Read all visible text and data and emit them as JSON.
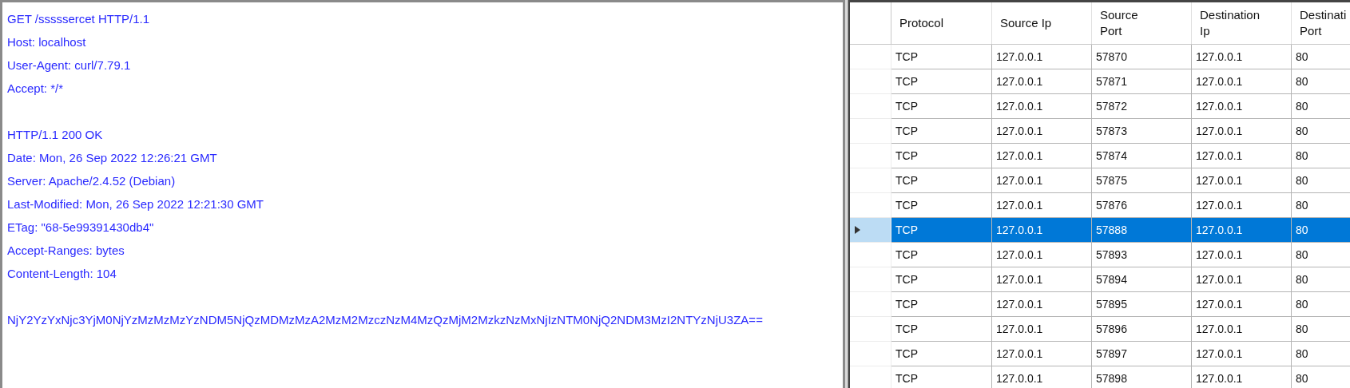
{
  "message_view": {
    "blocks": [
      {
        "lines": [
          "GET /sssssercet HTTP/1.1",
          "Host: localhost",
          "User-Agent: curl/7.79.1",
          "Accept: */*"
        ]
      },
      {
        "lines": [
          "HTTP/1.1 200 OK",
          "Date: Mon, 26 Sep 2022 12:26:21 GMT",
          "Server: Apache/2.4.52 (Debian)",
          "Last-Modified: Mon, 26 Sep 2022 12:21:30 GMT",
          "ETag: \"68-5e99391430db4\"",
          "Accept-Ranges: bytes",
          "Content-Length: 104"
        ]
      },
      {
        "lines": [
          "NjY2YzYxNjc3YjM0NjYzMzMzMzYzNDM5NjQzMDMzMzA2MzM2MzczNzM4MzQzMjM2MzkzNzMxNjIzNTM0NjQ2NDM3MzI2NTYzNjU3ZA=="
        ]
      }
    ]
  },
  "table": {
    "columns": [
      {
        "lines": [
          "Protocol"
        ]
      },
      {
        "lines": [
          "Source Ip"
        ]
      },
      {
        "lines": [
          "Source",
          "Port"
        ]
      },
      {
        "lines": [
          "Destination",
          "Ip"
        ]
      },
      {
        "lines": [
          "Destinati",
          "Port"
        ]
      }
    ],
    "rows": [
      {
        "selected": false,
        "cells": [
          "TCP",
          "127.0.0.1",
          "57870",
          "127.0.0.1",
          "80"
        ]
      },
      {
        "selected": false,
        "cells": [
          "TCP",
          "127.0.0.1",
          "57871",
          "127.0.0.1",
          "80"
        ]
      },
      {
        "selected": false,
        "cells": [
          "TCP",
          "127.0.0.1",
          "57872",
          "127.0.0.1",
          "80"
        ]
      },
      {
        "selected": false,
        "cells": [
          "TCP",
          "127.0.0.1",
          "57873",
          "127.0.0.1",
          "80"
        ]
      },
      {
        "selected": false,
        "cells": [
          "TCP",
          "127.0.0.1",
          "57874",
          "127.0.0.1",
          "80"
        ]
      },
      {
        "selected": false,
        "cells": [
          "TCP",
          "127.0.0.1",
          "57875",
          "127.0.0.1",
          "80"
        ]
      },
      {
        "selected": false,
        "cells": [
          "TCP",
          "127.0.0.1",
          "57876",
          "127.0.0.1",
          "80"
        ]
      },
      {
        "selected": true,
        "cells": [
          "TCP",
          "127.0.0.1",
          "57888",
          "127.0.0.1",
          "80"
        ]
      },
      {
        "selected": false,
        "cells": [
          "TCP",
          "127.0.0.1",
          "57893",
          "127.0.0.1",
          "80"
        ]
      },
      {
        "selected": false,
        "cells": [
          "TCP",
          "127.0.0.1",
          "57894",
          "127.0.0.1",
          "80"
        ]
      },
      {
        "selected": false,
        "cells": [
          "TCP",
          "127.0.0.1",
          "57895",
          "127.0.0.1",
          "80"
        ]
      },
      {
        "selected": false,
        "cells": [
          "TCP",
          "127.0.0.1",
          "57896",
          "127.0.0.1",
          "80"
        ]
      },
      {
        "selected": false,
        "cells": [
          "TCP",
          "127.0.0.1",
          "57897",
          "127.0.0.1",
          "80"
        ]
      },
      {
        "selected": false,
        "cells": [
          "TCP",
          "127.0.0.1",
          "57898",
          "127.0.0.1",
          "80"
        ]
      }
    ]
  }
}
